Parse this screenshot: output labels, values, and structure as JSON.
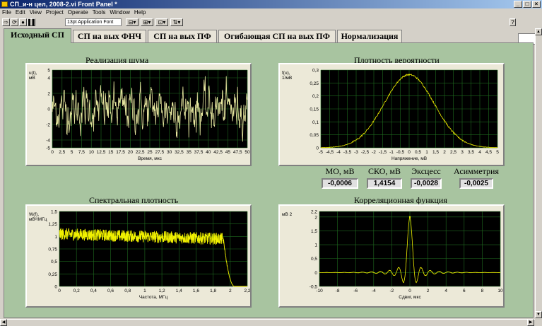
{
  "window": {
    "title": "СП_и-н цел, 2008-2.vi Front Panel *"
  },
  "menu": [
    "File",
    "Edit",
    "View",
    "Project",
    "Operate",
    "Tools",
    "Window",
    "Help"
  ],
  "toolbar": {
    "font": "13pt Application Font"
  },
  "tabs": [
    "Исходный СП",
    "СП на вых ФНЧ",
    "СП на вых ПФ",
    "Огибающая СП на вых ПФ",
    "Нормализация"
  ],
  "active_tab": 0,
  "stats": [
    {
      "label": "МО, мВ",
      "value": "-0,0006"
    },
    {
      "label": "СКО, мВ",
      "value": "1,4154"
    },
    {
      "label": "Эксцесс",
      "value": "-0,0028"
    },
    {
      "label": "Асимметрия",
      "value": "-0,0025"
    }
  ],
  "colors": {
    "panel": "#a8c4a0",
    "plot_bg": "#000000",
    "grid": "#1f6b1f",
    "trace": "#f0f000",
    "trace_noise": "#e8e8a0"
  },
  "chart_data": [
    {
      "type": "line",
      "title": "Реализация шума",
      "xlabel": "Время, мкс",
      "ylabel": "u(t),\nмВ",
      "xlim": [
        0,
        50
      ],
      "ylim": [
        -5,
        5
      ],
      "xticks": [
        "0",
        "2,5",
        "5",
        "7,5",
        "10",
        "12,5",
        "15",
        "17,5",
        "20",
        "22,5",
        "25",
        "27,5",
        "30",
        "32,5",
        "35",
        "37,5",
        "40",
        "42,5",
        "45",
        "47,5",
        "50"
      ],
      "yticks": [
        "5",
        "4",
        "2",
        "0",
        "-2",
        "-4",
        "-5"
      ],
      "series": [
        {
          "kind": "noise",
          "amplitude": 4.2,
          "std": 1.415
        }
      ]
    },
    {
      "type": "line",
      "title": "Плотность вероятности",
      "xlabel": "Напряжение, мВ",
      "ylabel": "f(u),\n1/мВ",
      "xlim": [
        -5,
        5
      ],
      "ylim": [
        0,
        0.3
      ],
      "xticks": [
        "-5",
        "-4,5",
        "-4",
        "-3,5",
        "-3",
        "-2,5",
        "-2",
        "-1,5",
        "-1",
        "-0,5",
        "0",
        "0,5",
        "1",
        "1,5",
        "2",
        "2,5",
        "3",
        "3,5",
        "4",
        "4,5",
        "5"
      ],
      "yticks": [
        "0,3",
        "0,25",
        "0,2",
        "0,15",
        "0,1",
        "0,05",
        "0"
      ],
      "series": [
        {
          "kind": "gaussian",
          "mean": 0,
          "std": 1.4154,
          "peak": 0.282
        }
      ]
    },
    {
      "type": "line",
      "title": "Спектральная плотность",
      "xlabel": "Частота, МГц",
      "ylabel": "W(f),\nмВ²/МГц",
      "xlim": [
        0,
        2.2
      ],
      "ylim": [
        0,
        1.5
      ],
      "xticks": [
        "0",
        "0,2",
        "0,4",
        "0,6",
        "0,8",
        "1",
        "1,2",
        "1,4",
        "1,6",
        "1,8",
        "2",
        "2,2"
      ],
      "yticks": [
        "1,5",
        "1,25",
        "1",
        "0,75",
        "0,5",
        "0,25",
        "0"
      ],
      "series": [
        {
          "kind": "spectrum",
          "level_start": 1.05,
          "level_end": 0.95,
          "noise": 0.12,
          "cutoff": 1.92,
          "zero_at": 2.05
        }
      ]
    },
    {
      "type": "line",
      "title": "Корреляционная функция",
      "xlabel": "Сдвиг, мкс",
      "ylabel": "мВ 2",
      "xlim": [
        -10,
        10
      ],
      "ylim": [
        -0.5,
        2.2
      ],
      "xticks": [
        "-10",
        "-8",
        "-6",
        "-4",
        "-2",
        "0",
        "2",
        "4",
        "6",
        "8",
        "10"
      ],
      "yticks": [
        "2,2",
        "2",
        "1,5",
        "1",
        "0,5",
        "0",
        "-0,5"
      ],
      "series": [
        {
          "kind": "sinc",
          "peak": 2.0,
          "width": 0.5
        }
      ]
    }
  ]
}
